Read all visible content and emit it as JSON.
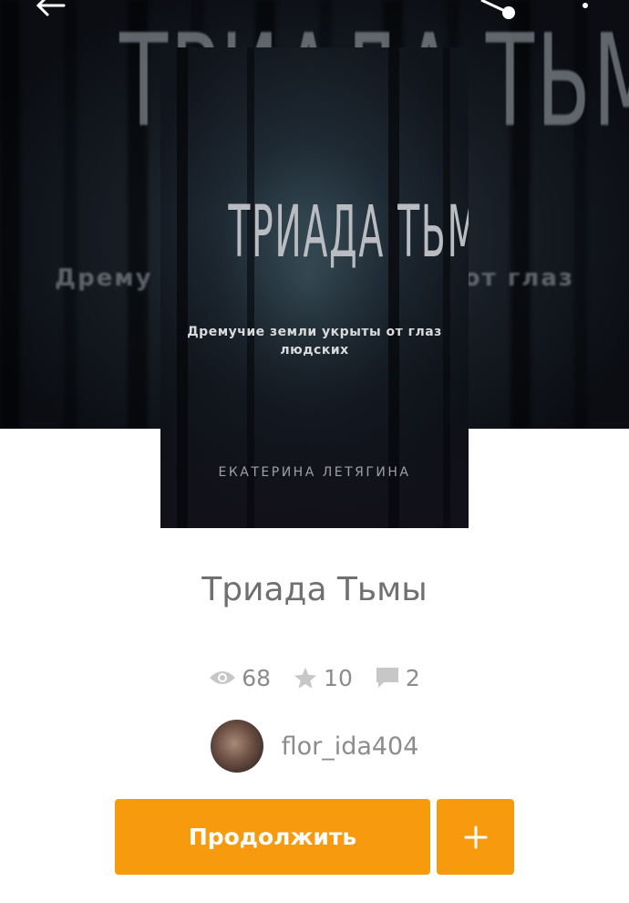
{
  "hero": {
    "bg_title": "ТРИАДА ТЬМЫ",
    "bg_sub_left": "Дрему",
    "bg_sub_right": "от глаз"
  },
  "topbar": {
    "back_icon": "arrow-left-icon",
    "share_icon": "share-icon",
    "more_icon": "more-vertical-icon"
  },
  "cover": {
    "title": "ТРИАДА ТЬМЫ",
    "subtitle": "Дремучие земли укрыты от глаз людских",
    "author": "ЕКАТЕРИНА ЛЕТЯГИНА"
  },
  "book": {
    "title": "Триада Тьмы"
  },
  "stats": {
    "views": "68",
    "stars": "10",
    "comments": "2"
  },
  "author": {
    "name": "flor_ida404"
  },
  "actions": {
    "continue_label": "Продолжить",
    "add_icon": "plus-icon"
  },
  "colors": {
    "accent": "#f89a0e",
    "text_secondary": "#8c8c8c",
    "title_text": "#707070"
  }
}
